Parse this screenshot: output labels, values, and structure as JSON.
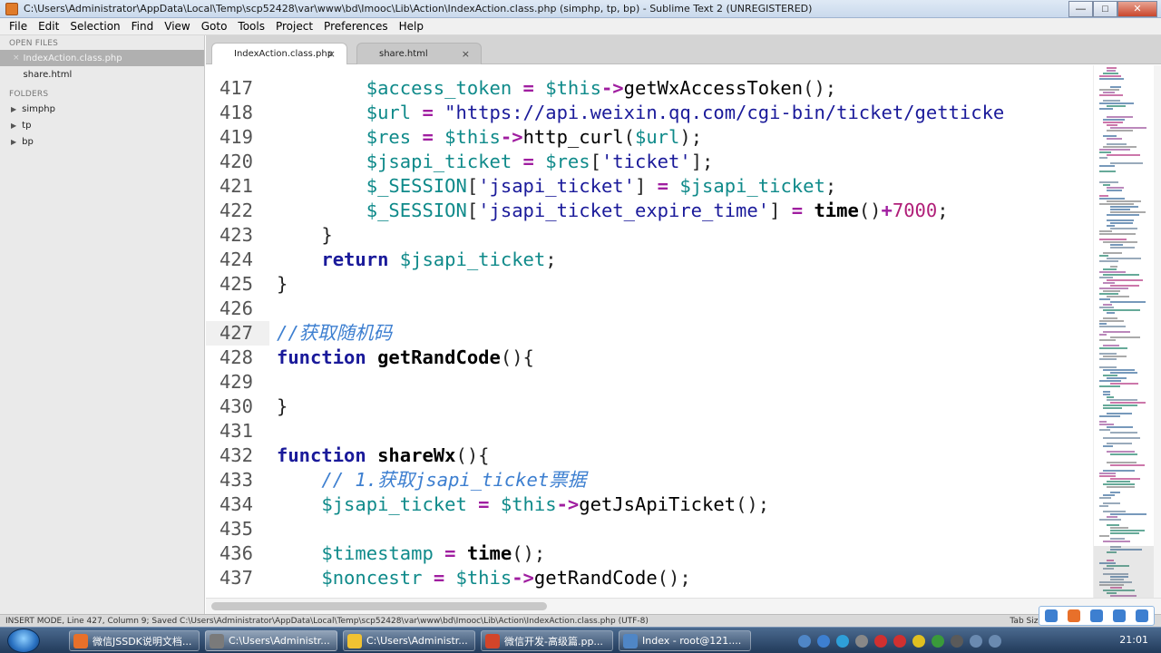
{
  "window": {
    "title": "C:\\Users\\Administrator\\AppData\\Local\\Temp\\scp52428\\var\\www\\bd\\Imooc\\Lib\\Action\\IndexAction.class.php (simphp, tp, bp) - Sublime Text 2 (UNREGISTERED)",
    "controls": {
      "minimize": "—",
      "maximize": "□",
      "close": "✕"
    }
  },
  "menu": [
    "File",
    "Edit",
    "Selection",
    "Find",
    "View",
    "Goto",
    "Tools",
    "Project",
    "Preferences",
    "Help"
  ],
  "sidebar": {
    "open_files_heading": "OPEN FILES",
    "open_files": [
      {
        "name": "IndexAction.class.php",
        "active": true
      },
      {
        "name": "share.html",
        "active": false
      }
    ],
    "folders_heading": "FOLDERS",
    "folders": [
      "simphp",
      "tp",
      "bp"
    ]
  },
  "tabs": [
    {
      "label": "IndexAction.class.php",
      "active": true,
      "close": "×"
    },
    {
      "label": "share.html",
      "active": false,
      "close": "×"
    }
  ],
  "editor": {
    "current_line": 427,
    "lines": [
      {
        "n": "417",
        "tokens": [
          [
            "ws",
            "        "
          ],
          [
            "var",
            "$access_token"
          ],
          [
            "punc",
            " "
          ],
          [
            "op",
            "="
          ],
          [
            "punc",
            " "
          ],
          [
            "var",
            "$this"
          ],
          [
            "op",
            "->"
          ],
          [
            "fn",
            "getWxAccessToken"
          ],
          [
            "punc",
            "();"
          ]
        ]
      },
      {
        "n": "418",
        "tokens": [
          [
            "ws",
            "        "
          ],
          [
            "var",
            "$url"
          ],
          [
            "punc",
            " "
          ],
          [
            "op",
            "="
          ],
          [
            "punc",
            " "
          ],
          [
            "str",
            "\"https://api.weixin.qq.com/cgi-bin/ticket/getticke"
          ]
        ]
      },
      {
        "n": "419",
        "tokens": [
          [
            "ws",
            "        "
          ],
          [
            "var",
            "$res"
          ],
          [
            "punc",
            " "
          ],
          [
            "op",
            "="
          ],
          [
            "punc",
            " "
          ],
          [
            "var",
            "$this"
          ],
          [
            "op",
            "->"
          ],
          [
            "fn",
            "http_curl"
          ],
          [
            "punc",
            "("
          ],
          [
            "var",
            "$url"
          ],
          [
            "punc",
            ");"
          ]
        ]
      },
      {
        "n": "420",
        "tokens": [
          [
            "ws",
            "        "
          ],
          [
            "var",
            "$jsapi_ticket"
          ],
          [
            "punc",
            " "
          ],
          [
            "op",
            "="
          ],
          [
            "punc",
            " "
          ],
          [
            "var",
            "$res"
          ],
          [
            "punc",
            "["
          ],
          [
            "str",
            "'ticket'"
          ],
          [
            "punc",
            "];"
          ]
        ]
      },
      {
        "n": "421",
        "tokens": [
          [
            "ws",
            "        "
          ],
          [
            "var",
            "$_SESSION"
          ],
          [
            "punc",
            "["
          ],
          [
            "str",
            "'jsapi_ticket'"
          ],
          [
            "punc",
            "] "
          ],
          [
            "op",
            "="
          ],
          [
            "punc",
            " "
          ],
          [
            "var",
            "$jsapi_ticket"
          ],
          [
            "punc",
            ";"
          ]
        ]
      },
      {
        "n": "422",
        "tokens": [
          [
            "ws",
            "        "
          ],
          [
            "var",
            "$_SESSION"
          ],
          [
            "punc",
            "["
          ],
          [
            "str",
            "'jsapi_ticket_expire_time'"
          ],
          [
            "punc",
            "] "
          ],
          [
            "op",
            "="
          ],
          [
            "punc",
            " "
          ],
          [
            "fnb",
            "time"
          ],
          [
            "punc",
            "()"
          ],
          [
            "op",
            "+"
          ],
          [
            "num",
            "7000"
          ],
          [
            "punc",
            ";"
          ]
        ]
      },
      {
        "n": "423",
        "tokens": [
          [
            "ws",
            "    "
          ],
          [
            "punc",
            "}"
          ]
        ]
      },
      {
        "n": "424",
        "tokens": [
          [
            "ws",
            "    "
          ],
          [
            "kw",
            "return"
          ],
          [
            "punc",
            " "
          ],
          [
            "var",
            "$jsapi_ticket"
          ],
          [
            "punc",
            ";"
          ]
        ]
      },
      {
        "n": "425",
        "tokens": [
          [
            "punc",
            "}"
          ]
        ]
      },
      {
        "n": "426",
        "tokens": []
      },
      {
        "n": "427",
        "tokens": [
          [
            "cmt",
            "//获取随机码"
          ]
        ]
      },
      {
        "n": "428",
        "tokens": [
          [
            "kw",
            "function"
          ],
          [
            "punc",
            " "
          ],
          [
            "fnb",
            "getRandCode"
          ],
          [
            "punc",
            "(){"
          ]
        ]
      },
      {
        "n": "429",
        "tokens": []
      },
      {
        "n": "430",
        "tokens": [
          [
            "punc",
            "}"
          ]
        ]
      },
      {
        "n": "431",
        "tokens": []
      },
      {
        "n": "432",
        "tokens": [
          [
            "kw",
            "function"
          ],
          [
            "punc",
            " "
          ],
          [
            "fnb",
            "shareWx"
          ],
          [
            "punc",
            "(){"
          ]
        ]
      },
      {
        "n": "433",
        "tokens": [
          [
            "ws",
            "    "
          ],
          [
            "cmt",
            "// 1.获取jsapi_ticket票据"
          ]
        ]
      },
      {
        "n": "434",
        "tokens": [
          [
            "ws",
            "    "
          ],
          [
            "var",
            "$jsapi_ticket"
          ],
          [
            "punc",
            " "
          ],
          [
            "op",
            "="
          ],
          [
            "punc",
            " "
          ],
          [
            "var",
            "$this"
          ],
          [
            "op",
            "->"
          ],
          [
            "fn",
            "getJsApiTicket"
          ],
          [
            "punc",
            "();"
          ]
        ]
      },
      {
        "n": "435",
        "tokens": []
      },
      {
        "n": "436",
        "tokens": [
          [
            "ws",
            "    "
          ],
          [
            "var",
            "$timestamp"
          ],
          [
            "punc",
            " "
          ],
          [
            "op",
            "="
          ],
          [
            "punc",
            " "
          ],
          [
            "fnb",
            "time"
          ],
          [
            "punc",
            "();"
          ]
        ]
      },
      {
        "n": "437",
        "tokens": [
          [
            "ws",
            "    "
          ],
          [
            "var",
            "$noncestr"
          ],
          [
            "punc",
            " "
          ],
          [
            "op",
            "="
          ],
          [
            "punc",
            " "
          ],
          [
            "var",
            "$this"
          ],
          [
            "op",
            "->"
          ],
          [
            "fn",
            "getRandCode"
          ],
          [
            "punc",
            "();"
          ]
        ]
      }
    ]
  },
  "status": {
    "text": "INSERT MODE, Line 427, Column 9; Saved C:\\Users\\Administrator\\AppData\\Local\\Temp\\scp52428\\var\\www\\bd\\Imooc\\Lib\\Action\\IndexAction.class.php (UTF-8)",
    "tab_size": "Tab Size"
  },
  "taskbar": {
    "items": [
      {
        "label": "微信JSSDK说明文档...",
        "color": "#e8702a"
      },
      {
        "label": "C:\\Users\\Administr...",
        "color": "#7a7a7a",
        "active": true
      },
      {
        "label": "C:\\Users\\Administr...",
        "color": "#f1c232"
      },
      {
        "label": "微信开发-高级篇.pp...",
        "color": "#d2452a"
      },
      {
        "label": "Index - root@121....",
        "color": "#4f86c6"
      }
    ],
    "clock": "21:01"
  }
}
